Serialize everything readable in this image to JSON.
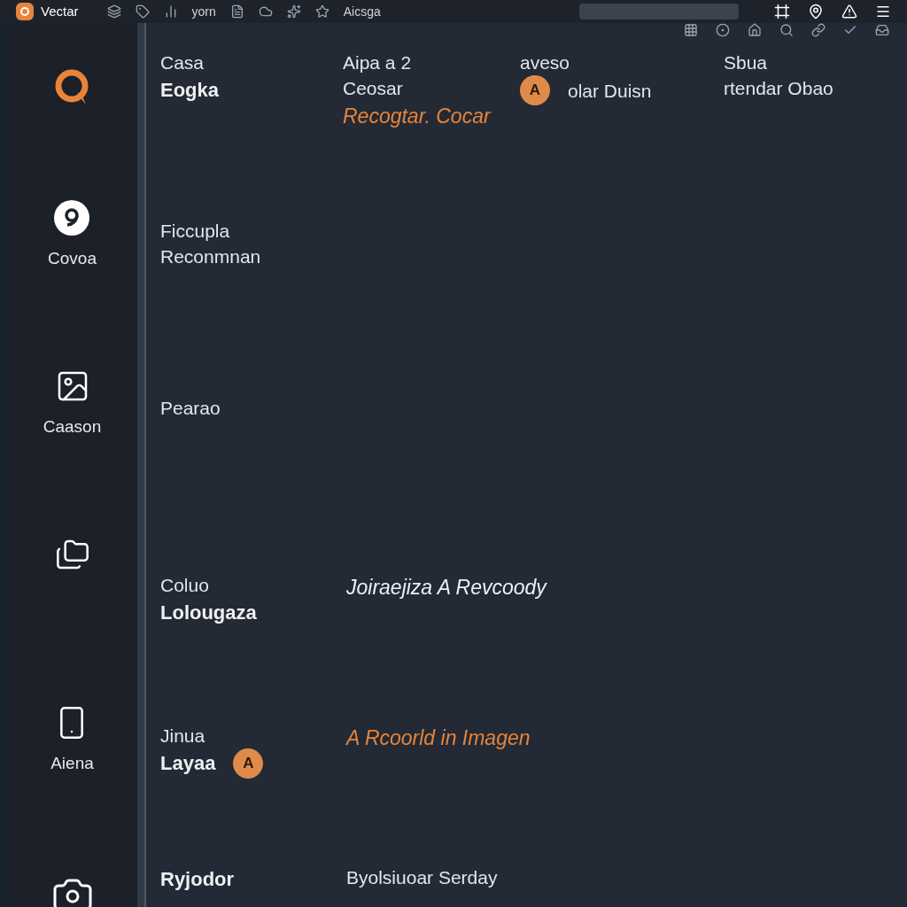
{
  "app": {
    "name": "Vectar"
  },
  "toolbar": {
    "labels": [
      "yorn",
      "Aicsga"
    ]
  },
  "sidebar": {
    "items": [
      {
        "kind": "logo"
      },
      {
        "kind": "labeled",
        "label": "Covoa"
      },
      {
        "kind": "labeled",
        "label": "Caason"
      },
      {
        "kind": "icon"
      },
      {
        "kind": "labeled",
        "label": "Aiena"
      },
      {
        "kind": "icon"
      }
    ]
  },
  "sections": [
    {
      "cells": [
        [
          {
            "kind": "plain",
            "text": "Casa"
          },
          {
            "kind": "bold",
            "text": "Eogka"
          }
        ],
        [
          {
            "kind": "plain",
            "text": "Aipa a 2"
          },
          {
            "kind": "plain",
            "text": "Ceosar"
          },
          {
            "kind": "accent",
            "text": "Recogtar. Cocar"
          }
        ],
        [
          {
            "kind": "plain",
            "text": "aveso"
          },
          {
            "kind": "badge",
            "text": "A"
          },
          {
            "kind": "plain",
            "text": "olar Duisn"
          }
        ],
        [
          {
            "kind": "plain",
            "text": "Sbua"
          },
          {
            "kind": "plain",
            "text": "rtendar Obao"
          }
        ]
      ]
    },
    {
      "cells": [
        [
          {
            "kind": "plain",
            "text": "Ficcupla"
          },
          {
            "kind": "plain",
            "text": "Reconmnan"
          }
        ]
      ]
    },
    {
      "cells": [
        [
          {
            "kind": "plain",
            "text": "Pearao"
          }
        ]
      ]
    },
    {
      "cells": [
        [
          {
            "kind": "plain",
            "text": "Coluo"
          },
          {
            "kind": "bold",
            "text": "Lolougaza"
          }
        ],
        [
          {
            "kind": "italic",
            "text": "Joiraejiza A Revcoody"
          }
        ]
      ]
    },
    {
      "cells": [
        [
          {
            "kind": "plain",
            "text": "Jinua"
          },
          {
            "kind": "bold",
            "text": "Layaa"
          },
          {
            "kind": "badge",
            "text": "A"
          }
        ],
        [
          {
            "kind": "accent",
            "text": "A Rcoorld in Imagen"
          }
        ]
      ]
    },
    {
      "cells": [
        [
          {
            "kind": "bold",
            "text": "Ryjodor"
          }
        ],
        [
          {
            "kind": "plain",
            "text": "Byolsiuoar Serday"
          }
        ]
      ]
    }
  ]
}
